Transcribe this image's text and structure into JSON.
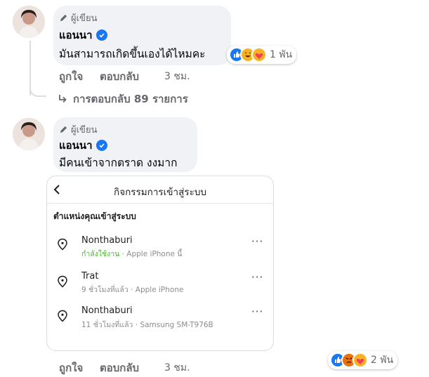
{
  "comments": [
    {
      "author_tag": "ผู้เขียน",
      "author_name": "แอนนา",
      "text": "มันสามารถเกิดขึ้นเองได้ไหมคะ",
      "reaction_count": "1 พัน",
      "actions": {
        "like": "ถูกใจ",
        "reply": "ตอบกลับ",
        "time": "3 ชม."
      },
      "replies_link": "การตอบกลับ 89 รายการ"
    },
    {
      "author_tag": "ผู้เขียน",
      "author_name": "แอนนา",
      "text": "มีคนเข้าจากตราด งงมาก",
      "reaction_count": "2 พัน",
      "actions": {
        "like": "ถูกใจ",
        "reply": "ตอบกลับ",
        "time": "3 ชม."
      }
    }
  ],
  "screenshot": {
    "header_title": "กิจกรรมการเข้าสู่ระบบ",
    "section_title": "ตำแหน่งคุณเข้าสู่ระบบ",
    "more_label": "···",
    "locations": [
      {
        "name": "Nonthaburi",
        "status": "กำลังใช้งาน",
        "device": " · Apple iPhone นี้"
      },
      {
        "name": "Trat",
        "status": "",
        "device": "9 ชั่วโมงที่แล้ว · Apple iPhone"
      },
      {
        "name": "Nonthaburi",
        "status": "",
        "device": "11 ชั่วโมงที่แล้ว · Samsung SM-T976B"
      }
    ]
  },
  "colors": {
    "verified": "#1877f2",
    "active_status": "#42b72a",
    "like": "#1877f2",
    "haha": "#f7b125",
    "love": "#f33e58",
    "angry": "#e9710f"
  },
  "icons": [
    "pencil-icon",
    "verified-icon",
    "reply-arrow-icon",
    "back-arrow-icon",
    "location-pin-icon",
    "like-reaction-icon",
    "haha-reaction-icon",
    "care-reaction-icon",
    "angry-reaction-icon"
  ]
}
